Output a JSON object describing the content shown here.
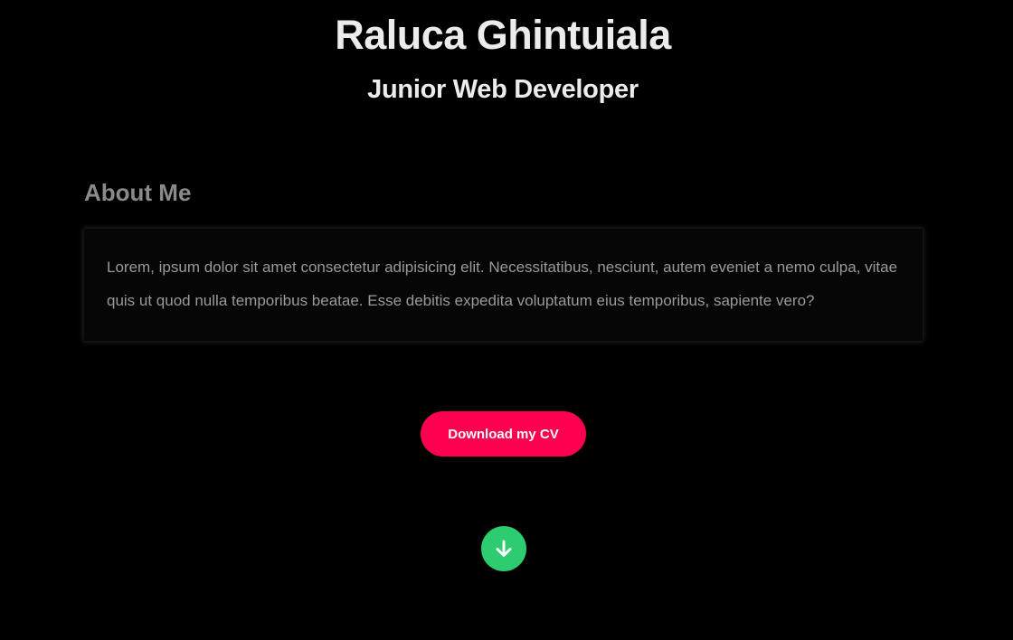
{
  "header": {
    "name": "Raluca Ghintuiala",
    "role": "Junior Web Developer"
  },
  "about": {
    "heading": "About Me",
    "text": "Lorem, ipsum dolor sit amet consectetur adipisicing elit. Necessitatibus, nesciunt, autem eveniet a nemo culpa, vitae quis ut quod nulla temporibus beatae. Esse debitis expedita voluptatum eius temporibus, sapiente vero?"
  },
  "cta": {
    "download_label": "Download my CV"
  },
  "scroll": {
    "icon": "arrow-down-icon"
  },
  "colors": {
    "background": "#000000",
    "accent": "#ff0050",
    "scroll_button": "#2ecc71"
  }
}
